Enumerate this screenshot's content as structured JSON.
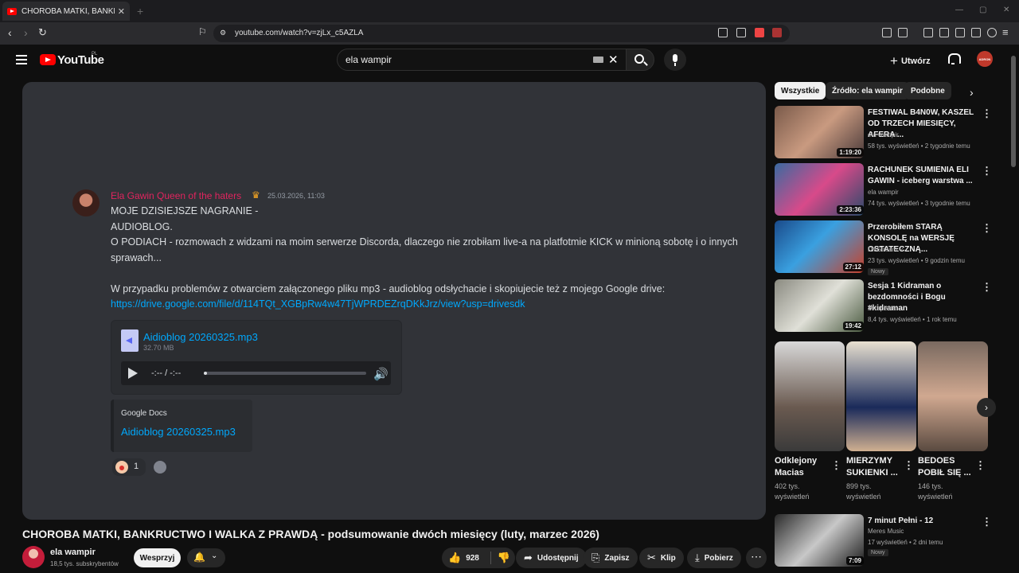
{
  "browser": {
    "tab_title": "CHOROBA MATKI, BANKRUCTWO",
    "url": "youtube.com/watch?v=zjLx_c5AZLA"
  },
  "header": {
    "logo_text": "YouTube",
    "logo_region": "PL",
    "search_value": "ela wampir",
    "create_label": "Utwórz",
    "avatar_text": "ADRON"
  },
  "post": {
    "author": "Ela Gawin Queen of the haters",
    "date": "25.03.2026, 11:03",
    "lines": [
      "MOJE DZISIEJSZE NAGRANIE -",
      "AUDIOBLOG.",
      "O PODIACH - rozmowach z widzami na moim serwerze Discorda, dlaczego nie zrobiłam live-a na platfotmie KICK w minioną sobotę i o innych",
      "sprawach...",
      "W przypadku problemów z otwarciem załączonego pliku mp3 - audioblog odsłychacie i skopiujecie też z mojego Google drive:"
    ],
    "link": "https://drive.google.com/file/d/114TQt_XGBpRw4w47TjWPRDEZrqDKkJrz/view?usp=drivesdk",
    "attachment": {
      "filename": "Aidioblog 20260325.mp3",
      "size": "32.70 MB",
      "time": "-:-- / -:--",
      "progress": 0.02
    },
    "embed": {
      "source": "Google Docs",
      "title": "Aidioblog 20260325.mp3"
    },
    "reaction_count": "1"
  },
  "video": {
    "title": "CHOROBA MATKI, BANKRUCTWO I WALKA Z PRAWDĄ - podsumowanie dwóch miesięcy (luty, marzec 2026)",
    "channel": "ela wampir",
    "subscribers": "18,5 tys. subskrybentów",
    "support_label": "Wesprzyj",
    "likes": "928",
    "share_label": "Udostępnij",
    "save_label": "Zapisz",
    "clip_label": "Klip",
    "download_label": "Pobierz"
  },
  "chips": [
    "Wszystkie",
    "Źródło: ela wampir",
    "Podobne"
  ],
  "recommendations": [
    {
      "title": "FESTIWAL B4N0W, KASZEL OD TRZECH MIESIĘCY, AFERA ...",
      "channel": "ela wampir",
      "meta": "58 tys. wyświetleń • 2 tygodnie temu",
      "duration": "1:19:20",
      "badge": ""
    },
    {
      "title": "RACHUNEK SUMIENIA ELI GAWIN - iceberg warstwa ...",
      "channel": "ela wampir",
      "meta": "74 tys. wyświetleń • 3 tygodnie temu",
      "duration": "2:23:36",
      "badge": ""
    },
    {
      "title": "Przerobiłem STARĄ KONSOLĘ na WERSJĘ OSTATECZNĄ...",
      "channel": "DisStream",
      "meta": "23 tys. wyświetleń • 9 godzin temu",
      "duration": "27:12",
      "badge": "Nowy"
    },
    {
      "title": "Sesja 1 Kidraman o bezdomności i Bogu #kidraman",
      "channel": "Terapeuta",
      "meta": "8,4 tys. wyświetleń • 1 rok temu",
      "duration": "19:42",
      "badge": ""
    }
  ],
  "shorts": [
    {
      "title": "Odklejony Macias",
      "views": "402 tys. wyświetleń"
    },
    {
      "title": "MIERZYMY SUKIENKI ...",
      "views": "899 tys. wyświetleń"
    },
    {
      "title": "BEDOES POBIŁ SIĘ ...",
      "views": "146 tys. wyświetleń"
    }
  ],
  "last_rec": {
    "title": "7 minut Pełni - 12",
    "channel": "Meres Music",
    "meta": "17 wyświetleń • 2 dni temu",
    "duration": "7:09",
    "badge": "Nowy"
  }
}
